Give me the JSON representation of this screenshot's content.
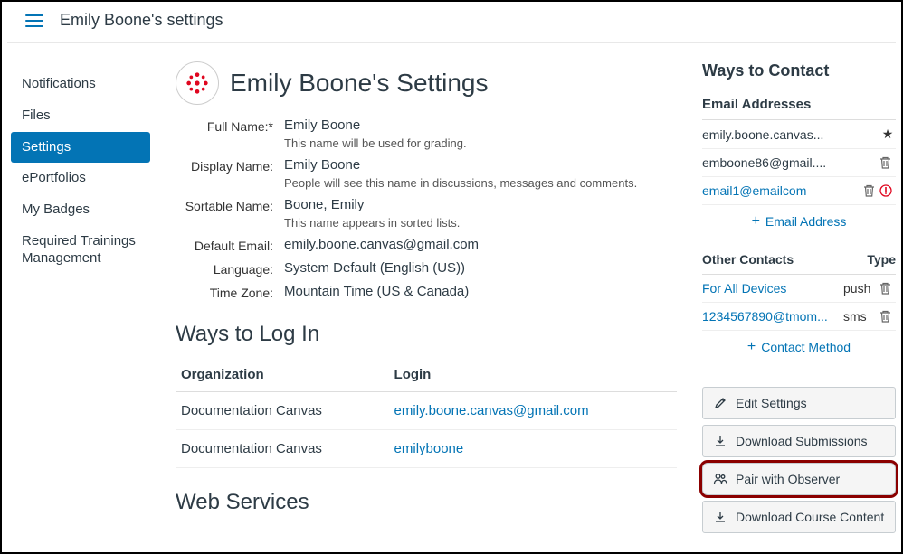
{
  "header": {
    "title": "Emily Boone's settings"
  },
  "sidebar": {
    "items": [
      {
        "label": "Notifications"
      },
      {
        "label": "Files"
      },
      {
        "label": "Settings"
      },
      {
        "label": "ePortfolios"
      },
      {
        "label": "My Badges"
      },
      {
        "label": "Required Train­ings Management"
      }
    ],
    "active_index": 2
  },
  "profile": {
    "heading": "Emily Boone's Settings",
    "fields": {
      "full_name_label": "Full Name:*",
      "full_name": "Emily Boone",
      "full_name_hint": "This name will be used for grading.",
      "display_name_label": "Display Name:",
      "display_name": "Emily Boone",
      "display_name_hint": "People will see this name in discussions, messages and comments.",
      "sortable_name_label": "Sortable Name:",
      "sortable_name": "Boone, Emily",
      "sortable_name_hint": "This name appears in sorted lists.",
      "default_email_label": "Default Email:",
      "default_email": "emily.boone.canvas@gmail.com",
      "language_label": "Language:",
      "language": "System Default (English (US))",
      "timezone_label": "Time Zone:",
      "timezone": "Mountain Time (US & Canada)"
    }
  },
  "login": {
    "heading": "Ways to Log In",
    "col_org": "Organization",
    "col_login": "Login",
    "rows": [
      {
        "org": "Documentation Canvas",
        "login": "emily.boone.canvas@gmail.com"
      },
      {
        "org": "Documentation Canvas",
        "login": "emilyboone"
      }
    ]
  },
  "webservices": {
    "heading": "Web Services"
  },
  "contact": {
    "heading": "Ways to Contact",
    "emails_heading": "Email Addresses",
    "emails": [
      {
        "addr": "emily.boone.canvas...",
        "star": true
      },
      {
        "addr": "emboone86@gmail....",
        "trash": true
      },
      {
        "addr": "email1@emailcom",
        "link": true,
        "trash": true,
        "warn": true
      }
    ],
    "add_email_label": "Email Address",
    "other_heading": "Other Contacts",
    "type_heading": "Type",
    "other": [
      {
        "addr": "For All Devices",
        "type": "push"
      },
      {
        "addr": "1234567890@tmom...",
        "type": "sms"
      }
    ],
    "add_contact_label": "Contact Method"
  },
  "actions": {
    "edit": "Edit Settings",
    "download_submissions": "Download Submissions",
    "pair_observer": "Pair with Observer",
    "download_course": "Download Course Content"
  }
}
